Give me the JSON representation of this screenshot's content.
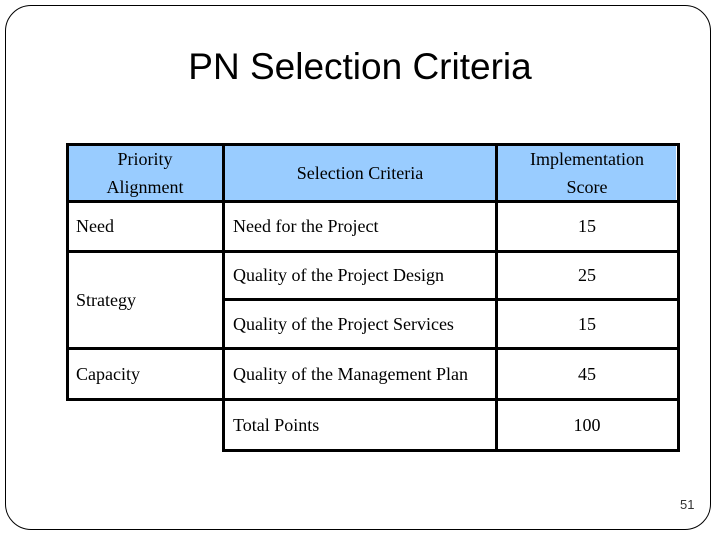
{
  "slide": {
    "title": "PN Selection Criteria",
    "page_number": "51",
    "header_color": "#99ccff"
  },
  "table": {
    "headers": {
      "priority": "Priority Alignment",
      "criteria": "Selection Criteria",
      "score": "Implementation Score"
    },
    "priority_groups": [
      {
        "label": "Need"
      },
      {
        "label": "Strategy"
      },
      {
        "label": "Capacity"
      }
    ],
    "rows": [
      {
        "criteria": "Need for the Project",
        "score": "15"
      },
      {
        "criteria": "Quality of the Project Design",
        "score": "25"
      },
      {
        "criteria": "Quality of the Project Services",
        "score": "15"
      },
      {
        "criteria": "Quality of the Management Plan",
        "score": "45"
      },
      {
        "criteria": "Total Points",
        "score": "100"
      }
    ]
  }
}
